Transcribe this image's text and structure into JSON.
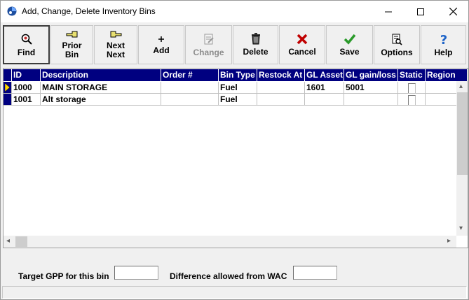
{
  "window": {
    "title": "Add, Change, Delete Inventory Bins"
  },
  "toolbar": {
    "buttons": [
      {
        "label": "Find",
        "icon": "magnifier-icon"
      },
      {
        "label": "Prior\nBin",
        "icon": "point-left-icon"
      },
      {
        "label": "Next\nNext",
        "icon": "point-right-icon"
      },
      {
        "label": "Add",
        "icon": "plus-icon"
      },
      {
        "label": "Change",
        "icon": "edit-document-icon",
        "disabled": true
      },
      {
        "label": "Delete",
        "icon": "trash-icon"
      },
      {
        "label": "Cancel",
        "icon": "red-x-icon"
      },
      {
        "label": "Save",
        "icon": "green-check-icon"
      },
      {
        "label": "Options",
        "icon": "options-icon"
      },
      {
        "label": "Help",
        "icon": "question-mark-icon"
      }
    ]
  },
  "grid": {
    "columns": [
      "ID",
      "Description",
      "Order #",
      "Bin Type",
      "Restock At",
      "GL Asset",
      "GL gain/loss",
      "Static",
      "Region"
    ],
    "rows": [
      {
        "id": "1000",
        "description": "MAIN STORAGE",
        "order": "",
        "bin_type": "Fuel",
        "restock": "",
        "gl_asset": "1601",
        "gl_gain_loss": "5001",
        "static": false,
        "region": "",
        "current": true
      },
      {
        "id": "1001",
        "description": "Alt storage",
        "order": "",
        "bin_type": "Fuel",
        "restock": "",
        "gl_asset": "",
        "gl_gain_loss": "",
        "static": false,
        "region": "",
        "current": false
      }
    ]
  },
  "fields": {
    "target_gpp_label": "Target GPP for this bin",
    "target_gpp_value": "",
    "difference_label": "Difference allowed from WAC",
    "difference_value": ""
  },
  "colors": {
    "header_bg": "#000080",
    "indicator": "#ffd700",
    "cancel_red": "#c00000",
    "save_green": "#2a9a2a",
    "help_blue": "#1e64c8"
  }
}
